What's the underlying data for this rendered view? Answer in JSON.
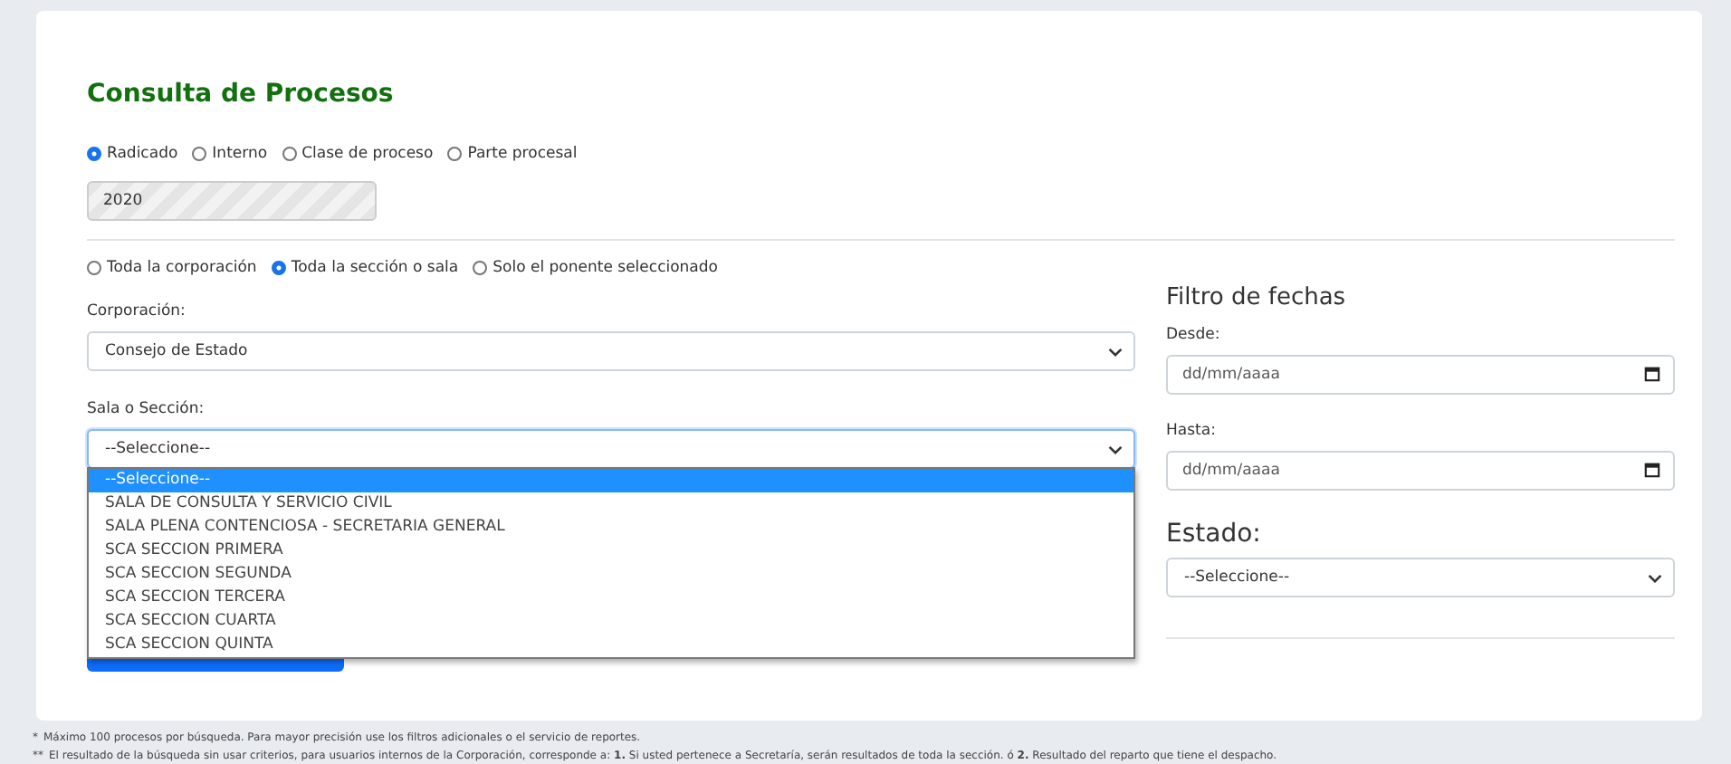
{
  "title": "Consulta de Procesos",
  "search_type": [
    {
      "label": "Radicado",
      "selected": true
    },
    {
      "label": "Interno",
      "selected": false
    },
    {
      "label": "Clase de proceso",
      "selected": false
    },
    {
      "label": "Parte procesal",
      "selected": false
    }
  ],
  "year_field": {
    "value": "2020",
    "disabled": true
  },
  "scope": [
    {
      "label": "Toda la corporación",
      "selected": false
    },
    {
      "label": "Toda la sección o sala",
      "selected": true
    },
    {
      "label": "Solo el ponente seleccionado",
      "selected": false
    }
  ],
  "corporacion": {
    "label": "Corporación:",
    "value": "Consejo de Estado"
  },
  "sala": {
    "label": "Sala o Sección:",
    "value": "--Seleccione--",
    "focused": true,
    "expanded": true,
    "options": [
      {
        "label": "--Seleccione--",
        "selected": true
      },
      {
        "label": "SALA DE CONSULTA Y SERVICIO CIVIL",
        "selected": false
      },
      {
        "label": "SALA PLENA CONTENCIOSA - SECRETARIA GENERAL",
        "selected": false
      },
      {
        "label": "SCA SECCION PRIMERA",
        "selected": false
      },
      {
        "label": "SCA SECCION SEGUNDA",
        "selected": false
      },
      {
        "label": "SCA SECCION TERCERA",
        "selected": false
      },
      {
        "label": "SCA SECCION CUARTA",
        "selected": false
      },
      {
        "label": "SCA SECCION QUINTA",
        "selected": false
      }
    ]
  },
  "date_filter": {
    "title": "Filtro de fechas",
    "from": {
      "label": "Desde:",
      "placeholder": "dd/mm/aaaa"
    },
    "to": {
      "label": "Hasta:",
      "placeholder": "dd/mm/aaaa"
    }
  },
  "estado": {
    "label": "Estado:",
    "value": "--Seleccione--"
  },
  "footnotes": [
    {
      "marker": "*",
      "text": "Máximo 100 procesos por búsqueda. Para mayor precisión use los filtros adicionales o el servicio de reportes."
    },
    {
      "marker": "**",
      "text": "El resultado de la búsqueda sin usar criterios, para usuarios internos de la Corporación, corresponde a: **1.** Si usted pertenece a Secretaría, serán resultados de toda la sección. ó **2.** Resultado del reparto que tiene el despacho."
    }
  ]
}
